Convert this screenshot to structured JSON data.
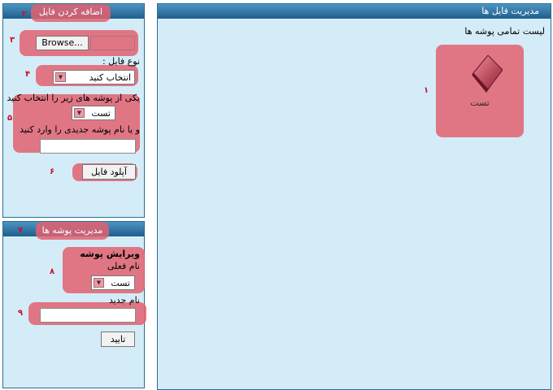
{
  "upload": {
    "title": "اضافه کردن فایل",
    "browse_label": "Browse...",
    "file_type_label": "نوع فایل :",
    "file_type_selected": "انتخاب کنید",
    "folder_instruction": "یکی از پوشه های زیر را انتخاب کنید",
    "folder_selected": "تست",
    "new_folder_instruction": "و یا نام پوشه جدیدی را وارد کنید",
    "new_folder_value": "",
    "upload_button": "آپلود فایل"
  },
  "folders": {
    "title": "مدیریت پوشه ها",
    "edit_heading": "ویرایش پوشه",
    "current_name_label": "نام فعلی",
    "current_name_selected": "تست",
    "new_name_label": "نام جدید",
    "new_name_value": "",
    "confirm_button": "تایید"
  },
  "main": {
    "title": "مدیریت فایل ها",
    "list_heading": "لیست تمامی پوشه ها",
    "folder_items": [
      {
        "label": "تست"
      }
    ]
  },
  "markers": [
    "۱",
    "۲",
    "۳",
    "۴",
    "۵",
    "۶",
    "۷",
    "۸",
    "۹"
  ],
  "colors": {
    "highlight": "#e26270",
    "panel_bg": "#d4ecf8",
    "title_bar": "#2b6c94",
    "marker": "#c8102e"
  }
}
